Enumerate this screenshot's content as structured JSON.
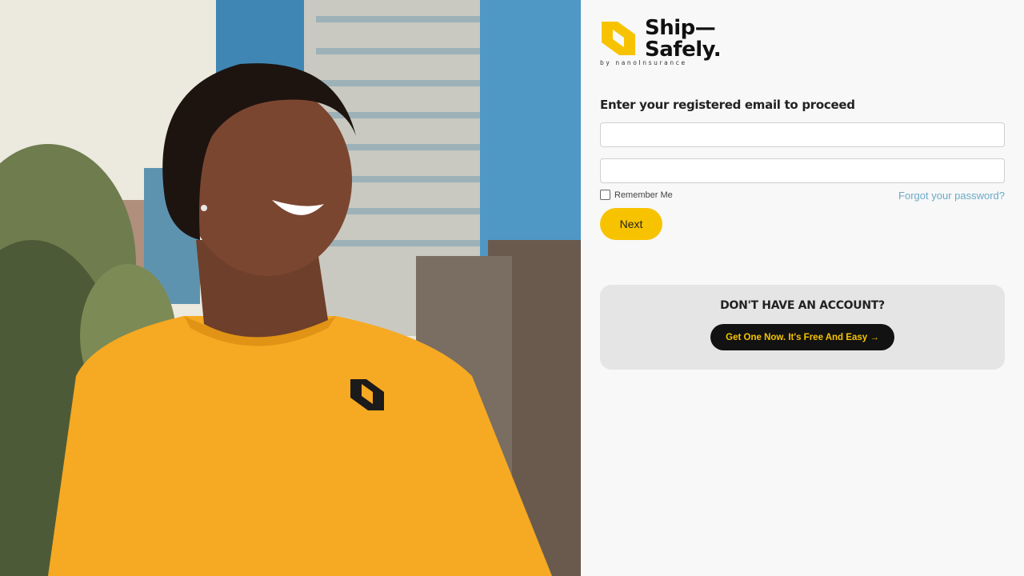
{
  "brand": {
    "name_line1": "Ship—",
    "name_line2": "Safely.",
    "byline": "by nanoInsurance",
    "accent_color": "#f7c300"
  },
  "hero": {
    "image": "smiling man in yellow t-shirt with S logo in front of glass office buildings"
  },
  "login": {
    "prompt": "Enter your registered email to proceed",
    "email_value": "",
    "password_value": "",
    "remember_label": "Remember Me",
    "remember_checked": false,
    "forgot_label": "Forgot your password?",
    "next_label": "Next"
  },
  "signup": {
    "title": "DON'T HAVE AN ACCOUNT?",
    "button_label": "Get One Now. It's Free And Easy →"
  },
  "icons": {
    "logo": "shipsafely-s-logo-icon",
    "checkbox": "checkbox-icon"
  }
}
